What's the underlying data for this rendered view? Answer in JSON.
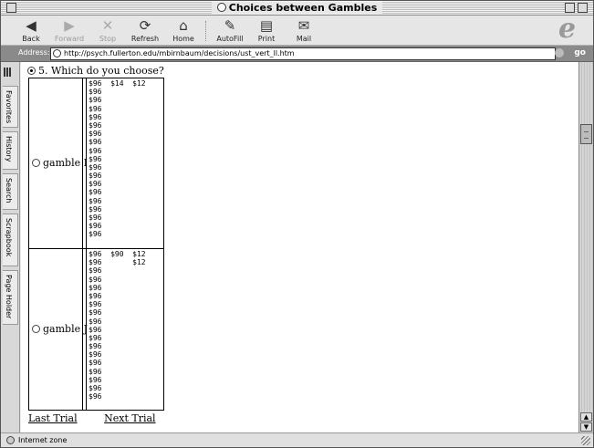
{
  "window": {
    "title": "Choices between Gambles"
  },
  "toolbar": {
    "back": "Back",
    "forward": "Forward",
    "stop": "Stop",
    "refresh": "Refresh",
    "home": "Home",
    "autofill": "AutoFill",
    "print": "Print",
    "mail": "Mail"
  },
  "address": {
    "label": "Address:",
    "url": "http://psych.fullerton.edu/mbirnbaum/decisions/ust_vert_ll.htm",
    "go": "go"
  },
  "sidebar": {
    "tabs": [
      "Favorites",
      "History",
      "Search",
      "Scrapbook",
      "Page Holder"
    ]
  },
  "question": {
    "text": "5. Which do you choose?",
    "selected": true
  },
  "gamble_i": {
    "label": "gamble I",
    "rows": [
      "$96  $14  $12",
      "$96",
      "$96",
      "$96",
      "$96",
      "$96",
      "$96",
      "$96",
      "$96",
      "$96",
      "$96",
      "$96",
      "$96",
      "$96",
      "$96",
      "$96",
      "$96",
      "$96",
      "$96"
    ]
  },
  "gamble_j": {
    "label": "gamble J",
    "rows": [
      "$96  $90  $12",
      "$96       $12",
      "$96",
      "$96",
      "$96",
      "$96",
      "$96",
      "$96",
      "$96",
      "$96",
      "$96",
      "$96",
      "$96",
      "$96",
      "$96",
      "$96",
      "$96",
      "$96"
    ]
  },
  "nav": {
    "last": "Last Trial",
    "next": "Next Trial"
  },
  "status": {
    "zone": "Internet zone"
  }
}
